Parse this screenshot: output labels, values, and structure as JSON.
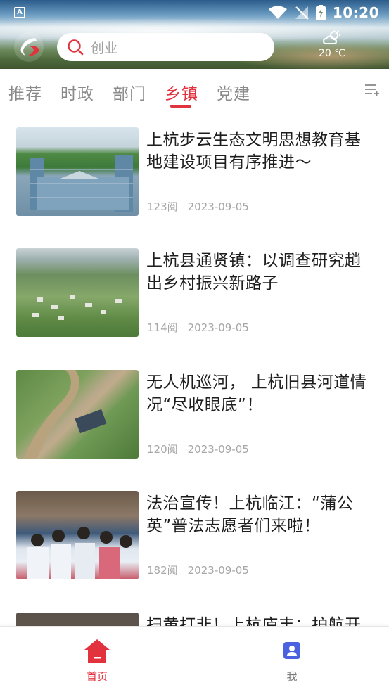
{
  "status_bar": {
    "time": "10:20"
  },
  "search": {
    "placeholder": "创业"
  },
  "weather": {
    "temperature": "20 ℃",
    "icon": "partly-cloudy-icon"
  },
  "tabs": [
    {
      "label": "推荐",
      "active": false
    },
    {
      "label": "时政",
      "active": false
    },
    {
      "label": "部门",
      "active": false
    },
    {
      "label": "乡镇",
      "active": true
    },
    {
      "label": "党建",
      "active": false
    }
  ],
  "news": [
    {
      "title": "上杭步云生态文明思想教育基地建设项目有序推进～",
      "views": "123阅",
      "date": "2023-09-05"
    },
    {
      "title": "上杭县通贤镇：以调查研究趟出乡村振兴新路子",
      "views": "114阅",
      "date": "2023-09-05"
    },
    {
      "title": "无人机巡河，  上杭旧县河道情况“尽收眼底”！",
      "views": "120阅",
      "date": "2023-09-05"
    },
    {
      "title": "法治宣传！上杭临江：“蒲公英”普法志愿者们来啦！",
      "views": "182阅",
      "date": "2023-09-05"
    },
    {
      "title": "扫黄打非！上杭庐丰：护航开",
      "views": "",
      "date": ""
    }
  ],
  "bottom_nav": [
    {
      "label": "首页",
      "icon": "home-icon",
      "active": true
    },
    {
      "label": "我",
      "icon": "profile-icon",
      "active": false
    }
  ],
  "colors": {
    "accent": "#e2323e",
    "tab_inactive": "#8a8a8a",
    "meta_text": "#a6a6a6",
    "profile_icon": "#4a62e0"
  }
}
